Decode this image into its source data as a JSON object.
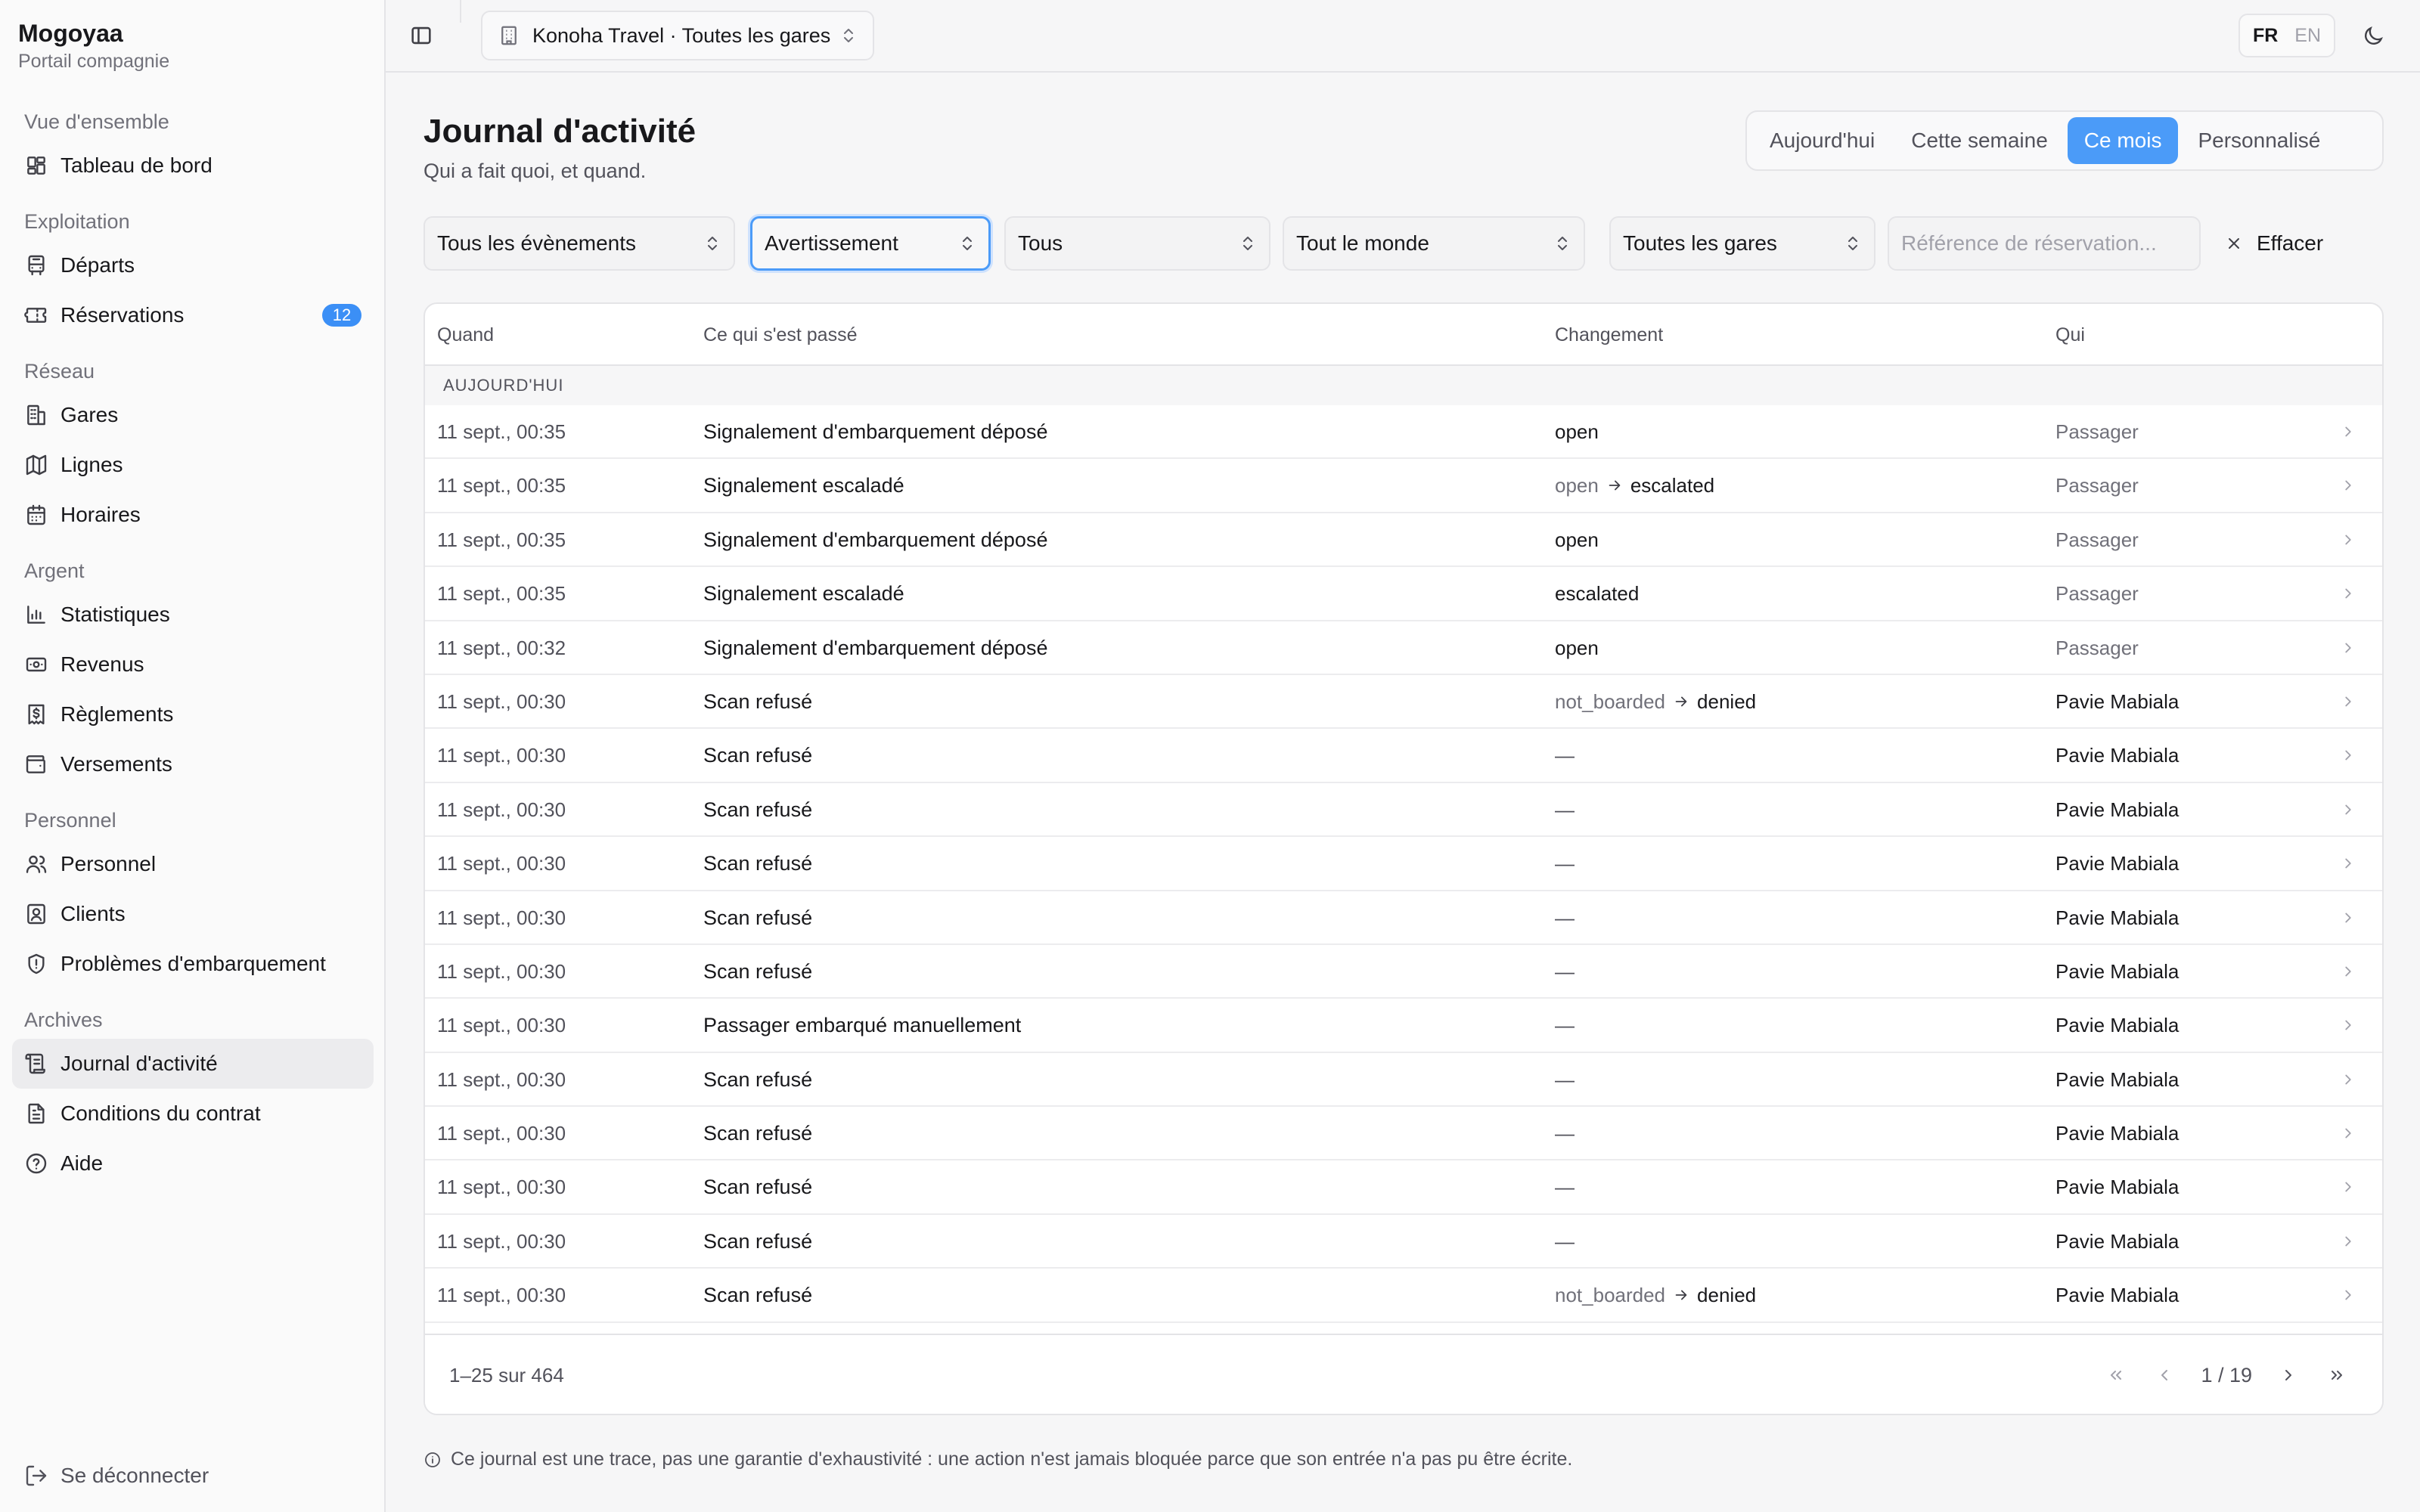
{
  "brand": {
    "name": "Mogoyaa",
    "subtitle": "Portail compagnie"
  },
  "sidebar": {
    "groups": [
      {
        "label": "Vue d'ensemble",
        "items": [
          {
            "label": "Tableau de bord",
            "icon": "dashboard-icon"
          }
        ]
      },
      {
        "label": "Exploitation",
        "items": [
          {
            "label": "Départs",
            "icon": "bus-icon"
          },
          {
            "label": "Réservations",
            "icon": "ticket-icon",
            "badge": "12"
          }
        ]
      },
      {
        "label": "Réseau",
        "items": [
          {
            "label": "Gares",
            "icon": "building-icon"
          },
          {
            "label": "Lignes",
            "icon": "map-icon"
          },
          {
            "label": "Horaires",
            "icon": "calendar-icon"
          }
        ]
      },
      {
        "label": "Argent",
        "items": [
          {
            "label": "Statistiques",
            "icon": "bar-chart-icon"
          },
          {
            "label": "Revenus",
            "icon": "banknote-icon"
          },
          {
            "label": "Règlements",
            "icon": "receipt-icon"
          },
          {
            "label": "Versements",
            "icon": "wallet-icon"
          }
        ]
      },
      {
        "label": "Personnel",
        "items": [
          {
            "label": "Personnel",
            "icon": "users-icon"
          },
          {
            "label": "Clients",
            "icon": "contact-icon"
          },
          {
            "label": "Problèmes d'embarquement",
            "icon": "shield-icon"
          }
        ]
      },
      {
        "label": "Archives",
        "items": [
          {
            "label": "Journal d'activité",
            "icon": "scroll-icon",
            "active": true
          },
          {
            "label": "Conditions du contrat",
            "icon": "document-icon"
          },
          {
            "label": "Aide",
            "icon": "help-icon"
          }
        ]
      }
    ],
    "logout": "Se déconnecter"
  },
  "topbar": {
    "company": "Konoha Travel · Toutes les gares",
    "lang_active": "FR",
    "lang_other": "EN"
  },
  "page": {
    "title": "Journal d'activité",
    "subtitle": "Qui a fait quoi, et quand."
  },
  "periods": [
    "Aujourd'hui",
    "Cette semaine",
    "Ce mois",
    "Personnalisé"
  ],
  "active_period": "Ce mois",
  "filters": {
    "event": "Tous les évènements",
    "severity": "Avertissement",
    "status": "Tous",
    "actor": "Tout le monde",
    "station": "Toutes les gares",
    "reference_placeholder": "Référence de réservation...",
    "clear": "Effacer"
  },
  "table": {
    "headers": {
      "when": "Quand",
      "what": "Ce qui s'est passé",
      "change": "Changement",
      "who": "Qui"
    },
    "group": "AUJOURD'HUI",
    "rows": [
      {
        "when": "11 sept., 00:35",
        "what": "Signalement d'embarquement déposé",
        "change_to": "open",
        "who": "Passager"
      },
      {
        "when": "11 sept., 00:35",
        "what": "Signalement escaladé",
        "change_from": "open",
        "change_to": "escalated",
        "who": "Passager"
      },
      {
        "when": "11 sept., 00:35",
        "what": "Signalement d'embarquement déposé",
        "change_to": "open",
        "who": "Passager"
      },
      {
        "when": "11 sept., 00:35",
        "what": "Signalement escaladé",
        "change_to": "escalated",
        "who": "Passager"
      },
      {
        "when": "11 sept., 00:32",
        "what": "Signalement d'embarquement déposé",
        "change_to": "open",
        "who": "Passager"
      },
      {
        "when": "11 sept., 00:30",
        "what": "Scan refusé",
        "change_from": "not_boarded",
        "change_to": "denied",
        "who": "Pavie Mabiala"
      },
      {
        "when": "11 sept., 00:30",
        "what": "Scan refusé",
        "change_none": "—",
        "who": "Pavie Mabiala"
      },
      {
        "when": "11 sept., 00:30",
        "what": "Scan refusé",
        "change_none": "—",
        "who": "Pavie Mabiala"
      },
      {
        "when": "11 sept., 00:30",
        "what": "Scan refusé",
        "change_none": "—",
        "who": "Pavie Mabiala"
      },
      {
        "when": "11 sept., 00:30",
        "what": "Scan refusé",
        "change_none": "—",
        "who": "Pavie Mabiala"
      },
      {
        "when": "11 sept., 00:30",
        "what": "Scan refusé",
        "change_none": "—",
        "who": "Pavie Mabiala"
      },
      {
        "when": "11 sept., 00:30",
        "what": "Passager embarqué manuellement",
        "change_none": "—",
        "who": "Pavie Mabiala"
      },
      {
        "when": "11 sept., 00:30",
        "what": "Scan refusé",
        "change_none": "—",
        "who": "Pavie Mabiala"
      },
      {
        "when": "11 sept., 00:30",
        "what": "Scan refusé",
        "change_none": "—",
        "who": "Pavie Mabiala"
      },
      {
        "when": "11 sept., 00:30",
        "what": "Scan refusé",
        "change_none": "—",
        "who": "Pavie Mabiala"
      },
      {
        "when": "11 sept., 00:30",
        "what": "Scan refusé",
        "change_none": "—",
        "who": "Pavie Mabiala"
      },
      {
        "when": "11 sept., 00:30",
        "what": "Scan refusé",
        "change_from": "not_boarded",
        "change_to": "denied",
        "who": "Pavie Mabiala"
      }
    ]
  },
  "pagination": {
    "range": "1–25 sur 464",
    "pages": "1 / 19"
  },
  "footnote": "Ce journal est une trace, pas une garantie d'exhaustivité : une action n'est jamais bloquée parce que son entrée n'a pas pu être écrite.",
  "colors": {
    "accent": "#4b9bf8",
    "badge": "#3b8ff6",
    "text": "#18181b",
    "muted": "#71717a"
  }
}
